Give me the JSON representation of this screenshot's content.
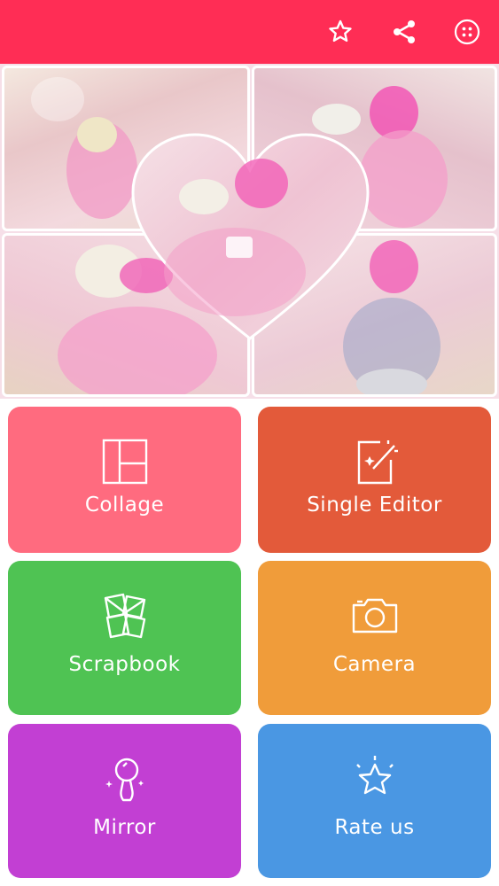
{
  "topbar": {
    "color": "#ff2d55",
    "icons": [
      "star-icon",
      "share-icon",
      "more-icon"
    ]
  },
  "banner": {
    "description_icons": [
      "photo-collage"
    ]
  },
  "menu": {
    "collage": {
      "label": "Collage",
      "color": "#ff6b7f",
      "icon": "collage-grid-icon"
    },
    "single_editor": {
      "label": "Single Editor",
      "color": "#e35a3a",
      "icon": "magic-edit-icon"
    },
    "scrapbook": {
      "label": "Scrapbook",
      "color": "#4fc353",
      "icon": "scrapbook-icon"
    },
    "camera": {
      "label": "Camera",
      "color": "#f09c3a",
      "icon": "camera-icon"
    },
    "mirror": {
      "label": "Mirror",
      "color": "#c23fd3",
      "icon": "mirror-icon"
    },
    "rate": {
      "label": "Rate us",
      "color": "#4a97e3",
      "icon": "star-icon"
    }
  }
}
